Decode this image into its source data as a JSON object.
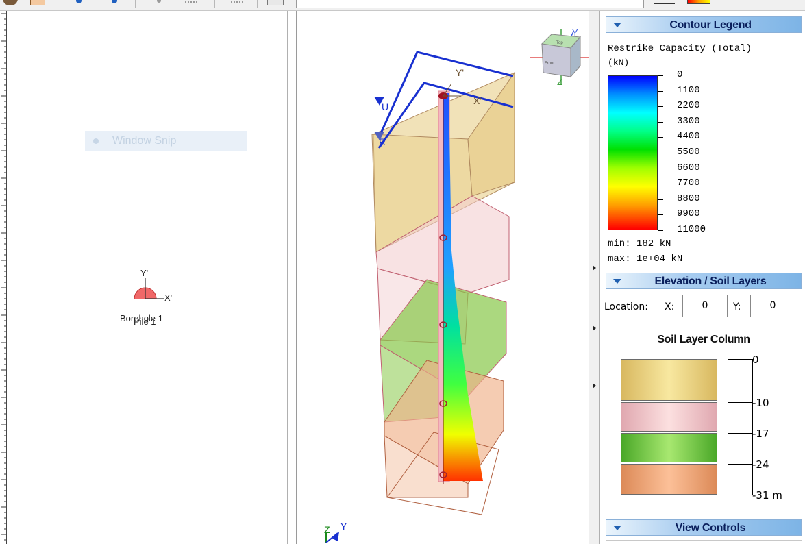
{
  "plan_view": {
    "window_snip": "Window Snip",
    "axis_y": "Y'",
    "axis_x": "X'",
    "label_borehole": "Borehole 1",
    "label_pile": "Pile 1"
  },
  "view3d": {
    "label_y_prime": "Y'",
    "label_x_prime": "X'",
    "label_u": "U",
    "label_r": "R",
    "triad": {
      "z": "Z",
      "y": "Y"
    },
    "cube": {
      "y": "Y",
      "z": "Z",
      "top": "Top",
      "front": "Front"
    }
  },
  "contour_legend": {
    "title": "Contour Legend",
    "quantity": "Restrike Capacity (Total)",
    "units": "(kN)",
    "ticks": [
      "0",
      "1100",
      "2200",
      "3300",
      "4400",
      "5500",
      "6600",
      "7700",
      "8800",
      "9900",
      "11000"
    ],
    "min": "min: 182 kN",
    "max": "max: 1e+04 kN",
    "colors": {
      "low": "#0000ff",
      "high": "#ff0000"
    }
  },
  "elevation": {
    "title": "Elevation / Soil Layers",
    "location_label": "Location:",
    "x_label": "X:",
    "x_value": "0",
    "y_label": "Y:",
    "y_value": "0",
    "column_title": "Soil Layer Column",
    "layer_colors": [
      "#e8cf7e",
      "#f0c8ca",
      "#7cc84a",
      "#eda476"
    ],
    "elevations": [
      "0",
      "-10",
      "-17",
      "-24",
      "-31 m"
    ]
  },
  "view_controls": {
    "title": "View Controls"
  }
}
